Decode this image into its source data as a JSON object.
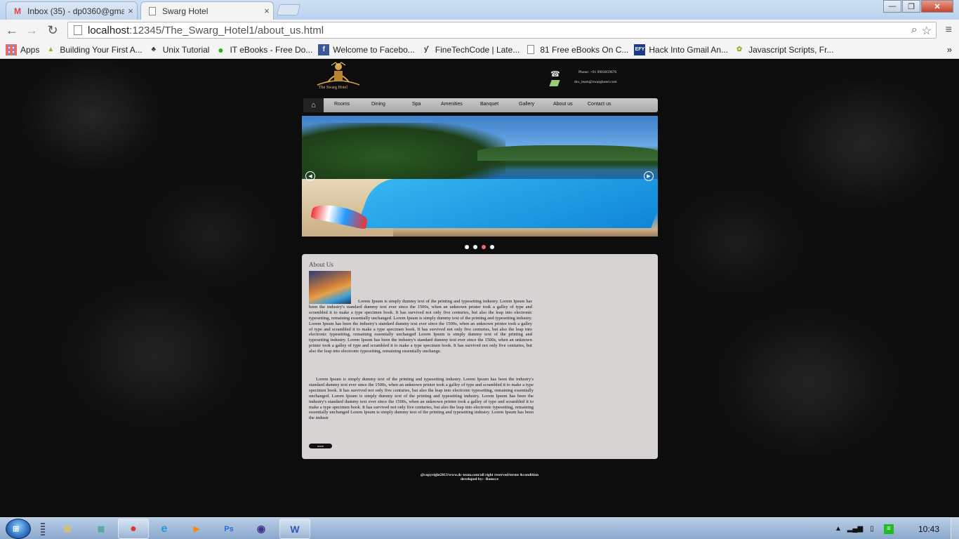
{
  "browser": {
    "tabs": [
      {
        "label": "Inbox (35) - dp0360@gma",
        "icon": "gmail-icon",
        "close": "×"
      },
      {
        "label": "Swarg Hotel",
        "icon": "page-icon",
        "close": "×"
      }
    ],
    "window_buttons": {
      "minimize": "—",
      "maximize": "❐",
      "close": "✕"
    },
    "address": {
      "host": "localhost",
      "path": ":12345/The_Swarg_Hotel1/about_us.html"
    },
    "nav": {
      "back": "←",
      "forward": "→",
      "reload": "↻",
      "menu": "≡"
    },
    "bookmarks": [
      {
        "label": "Apps",
        "icon": "apps-grid-icon"
      },
      {
        "label": "Building Your First A...",
        "icon": "android-icon"
      },
      {
        "label": "Unix Tutorial",
        "icon": "unix-icon"
      },
      {
        "label": "IT eBooks - Free Do...",
        "icon": "green-dot-icon"
      },
      {
        "label": "Welcome to Facebo...",
        "icon": "facebook-icon"
      },
      {
        "label": "FineTechCode | Late...",
        "icon": "ftc-icon"
      },
      {
        "label": "81 Free eBooks On C...",
        "icon": "page-icon"
      },
      {
        "label": "Hack Into Gmail An...",
        "icon": "efy-icon"
      },
      {
        "label": "Javascript Scripts, Fr...",
        "icon": "js-icon"
      }
    ],
    "bookmarks_more": "»"
  },
  "site": {
    "logo_text": "The Swarg Hotel",
    "phone": "Phone: +91 9903059676",
    "email": "dcs_team@swarghotel.com",
    "nav": [
      "Rooms",
      "Dining",
      "Spa",
      "Amenities",
      "Banquet",
      "Gallery",
      "About us",
      "Contact us"
    ],
    "slider_prev": "◀",
    "slider_next": "▶",
    "slider_dots": 4,
    "slider_active_dot": 2,
    "about": {
      "title": "About Us",
      "para1": "Lorem Ipsum is simply dummy text of the printing and typesetting industry. Lorem Ipsum has been the industry's standard dummy text ever since the 1500s, when an unknown printer took a galley of type and scrambled it to make a type specimen book. It has survived not only five centuries, but also the leap into electronic typesetting, remaining essentially unchanged. Lorem Ipsum is simply dummy text of the printing and typesetting industry. Lorem Ipsum has been the industry's standard dummy text ever since the 1500s, when an unknown printer took a galley of type and scrambled it to make a type specimen book. It has survived not only five centuries, but also the leap into electronic typesetting, remaining essentially unchanged Lorem Ipsum is simply dummy text of the printing and typesetting industry. Lorem Ipsum has been the industry's standard dummy text ever since the 1500s, when an unknown printer took a galley of type and scrambled it to make a type specimen book. It has survived not only five centuries, but also the leap into electronic typesetting, remaining essentially unchange.",
      "para2": "Lorem Ipsum is simply dummy text of the printing and typesetting industry. Lorem Ipsum has been the industry's standard dummy text ever since the 1500s, when an unknown printer took a galley of type and scrambled it to make a type specimen book. It has survived not only five centuries, but also the leap into electronic typesetting, remaining essentially unchanged. Lorem Ipsum is simply dummy text of the printing and typesetting industry. Lorem Ipsum has been the industry's standard dummy text ever since the 1500s, when an unknown printer took a galley of type and scrambled it to make a type specimen book. It has survived not only five centuries, but also the leap into electronic typesetting, remaining essentially unchanged Lorem Ipsum is simply dummy text of the printing and typesetting industry. Lorem Ipsum has been the industr",
      "more_label": "more"
    },
    "footer_line1": "@copyright2013/www.dc-team.com/all right reserved/terms &condition",
    "footer_line2": "developed by:- Bamcce"
  },
  "taskbar": {
    "start_label": "⊞",
    "apps": [
      {
        "icon": "explorer-folder-icon",
        "glyph": "▤",
        "color": "#e8c04a"
      },
      {
        "icon": "windows-explorer-icon",
        "glyph": "▦",
        "color": "#5a9"
      },
      {
        "icon": "chrome-icon",
        "glyph": "●",
        "color": "#d33",
        "pinned": true
      },
      {
        "icon": "internet-explorer-icon",
        "glyph": "e",
        "color": "#29d"
      },
      {
        "icon": "media-player-icon",
        "glyph": "▶",
        "color": "#f80"
      },
      {
        "icon": "photoshop-icon",
        "glyph": "Ps",
        "color": "#2a6ad8"
      },
      {
        "icon": "eclipse-icon",
        "glyph": "◉",
        "color": "#42338a"
      },
      {
        "icon": "word-icon",
        "glyph": "W",
        "color": "#2a5cb8",
        "pinned": true
      }
    ],
    "clock": "10:43"
  }
}
